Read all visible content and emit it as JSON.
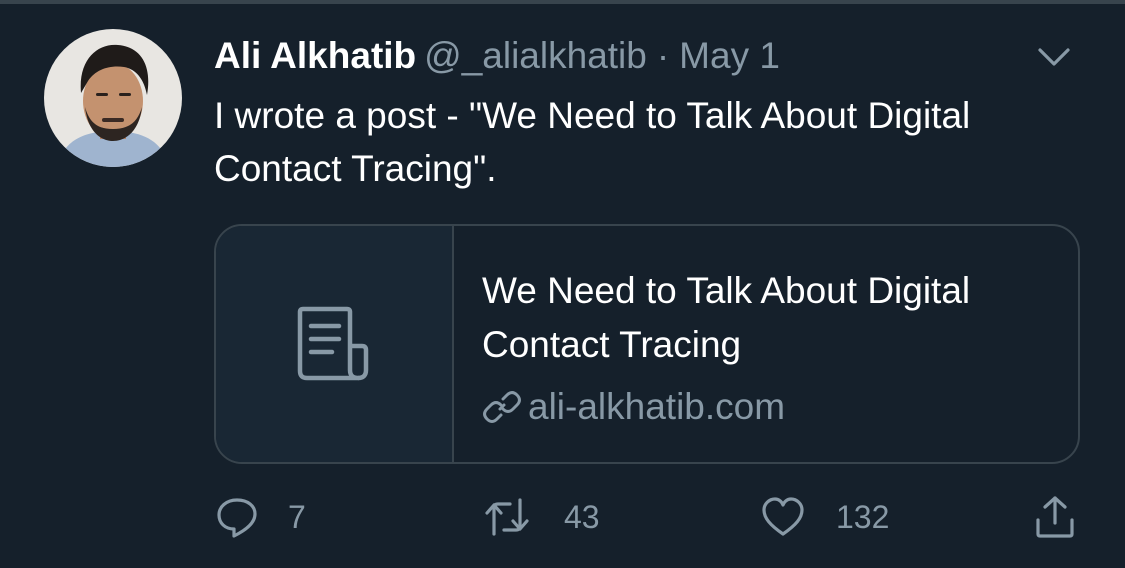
{
  "colors": {
    "background": "#15202b",
    "secondary_text": "#8899a6",
    "border": "#38444d",
    "card_thumb_bg": "#192734",
    "primary_text": "#ffffff"
  },
  "tweet": {
    "author_name": "Ali Alkhatib",
    "handle": "@_alialkhatib",
    "separator": "·",
    "date": "May 1",
    "text": "I wrote a post - \"We Need to Talk About Digital Contact Tracing\".",
    "avatar_icon": "profile-photo",
    "menu_icon": "chevron-down-icon"
  },
  "card": {
    "thumbnail_icon": "document-icon",
    "title": "We Need to Talk About Digital Contact Tracing",
    "link_icon": "link-icon",
    "domain": "ali-alkhatib.com"
  },
  "actions": {
    "reply": {
      "icon": "reply-icon",
      "count": "7"
    },
    "retweet": {
      "icon": "retweet-icon",
      "count": "43"
    },
    "like": {
      "icon": "heart-icon",
      "count": "132"
    },
    "share": {
      "icon": "share-icon"
    }
  }
}
